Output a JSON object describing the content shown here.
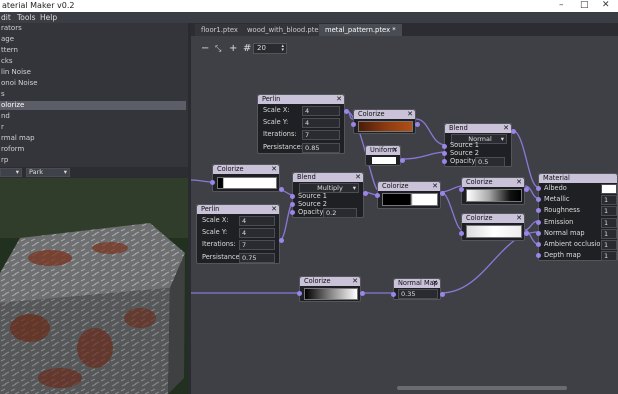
{
  "window": {
    "title": "aterial Maker v0.2"
  },
  "menu": [
    "dit",
    "Tools",
    "Help"
  ],
  "library": {
    "items": [
      "rators",
      "age",
      "ttern",
      "cks",
      "lin Noise",
      "onoi Noise",
      "s",
      "olorize",
      "nd",
      "r",
      "rmal map",
      "roform",
      "rp"
    ],
    "selected_index": 7
  },
  "preview": {
    "selector_value": "",
    "environment_value": "Park"
  },
  "tabs": [
    {
      "label": "floor1.ptex"
    },
    {
      "label": "wood_with_blood.ptex"
    },
    {
      "label": "metal_pattern.ptex *",
      "active": true
    }
  ],
  "toolbar": {
    "minus": "−",
    "fit": "⤡",
    "plus": "+",
    "grid_icon": "#",
    "snap_value": "20"
  },
  "nodes": {
    "perlin1": {
      "title": "Perlin",
      "scale_x_label": "Scale X:",
      "scale_x": "4",
      "scale_y_label": "Scale Y:",
      "scale_y": "4",
      "iterations_label": "Iterations:",
      "iterations": "7",
      "persistance_label": "Persistance:",
      "persistance": "0.85"
    },
    "perlin2": {
      "title": "Perlin",
      "scale_x_label": "Scale X:",
      "scale_x": "4",
      "scale_y_label": "Scale Y:",
      "scale_y": "4",
      "iterations_label": "Iterations:",
      "iterations": "7",
      "persistance_label": "Persistance:",
      "persistance": "0.75"
    },
    "colorize_top": {
      "title": "Colorize"
    },
    "uniform": {
      "title": "Uniform"
    },
    "blend_top": {
      "title": "Blend",
      "mode": "Normal",
      "source1": "Source 1",
      "source2": "Source 2",
      "opacity_label": "Opacity",
      "opacity": "0.5"
    },
    "colorize_left": {
      "title": "Colorize"
    },
    "blend_mid": {
      "title": "Blend",
      "mode": "Multiply",
      "source1": "Source 1",
      "source2": "Source 2",
      "opacity_label": "Opacity",
      "opacity": "0.2"
    },
    "colorize_mid": {
      "title": "Colorize"
    },
    "colorize_r1": {
      "title": "Colorize"
    },
    "colorize_r2": {
      "title": "Colorize"
    },
    "colorize_bottom": {
      "title": "Colorize"
    },
    "normal_map": {
      "title": "Normal Map",
      "value": "0.35"
    },
    "material": {
      "title": "Material",
      "inputs": [
        {
          "label": "Albedo",
          "value": ""
        },
        {
          "label": "Metallic",
          "value": "1"
        },
        {
          "label": "Roughness",
          "value": "1"
        },
        {
          "label": "Emission",
          "value": "1"
        },
        {
          "label": "Normal map",
          "value": "1"
        },
        {
          "label": "Ambient occlusion",
          "value": "1"
        },
        {
          "label": "Depth map",
          "value": "1"
        }
      ]
    }
  },
  "colors": {
    "port": "#9b85e8",
    "wire": "#8a78d8",
    "node_header": "#c9c2d8",
    "rust": "#8a3a10"
  },
  "icons": {
    "close": "✕",
    "dropdown": "▾"
  }
}
